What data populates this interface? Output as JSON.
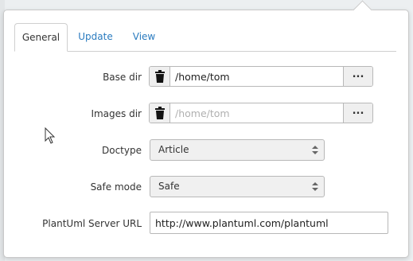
{
  "tabs": [
    {
      "label": "General",
      "active": true
    },
    {
      "label": "Update",
      "active": false
    },
    {
      "label": "View",
      "active": false
    }
  ],
  "form": {
    "base_dir": {
      "label": "Base dir",
      "value": "/home/tom",
      "placeholder": "/home/tom",
      "browse_label": "..."
    },
    "images_dir": {
      "label": "Images dir",
      "value": "",
      "placeholder": "/home/tom",
      "browse_label": "..."
    },
    "doctype": {
      "label": "Doctype",
      "value": "Article"
    },
    "safe_mode": {
      "label": "Safe mode",
      "value": "Safe"
    },
    "plantuml_url": {
      "label": "PlantUml Server URL",
      "value": "http://www.plantuml.com/plantuml"
    }
  },
  "icons": {
    "trash": "trash-icon",
    "select_caret": "up-down-caret-icon",
    "pointer": "mouse-pointer-icon"
  },
  "colors": {
    "link": "#2a7bbf",
    "border": "#b8b8b8",
    "button_bg": "#efefef"
  }
}
